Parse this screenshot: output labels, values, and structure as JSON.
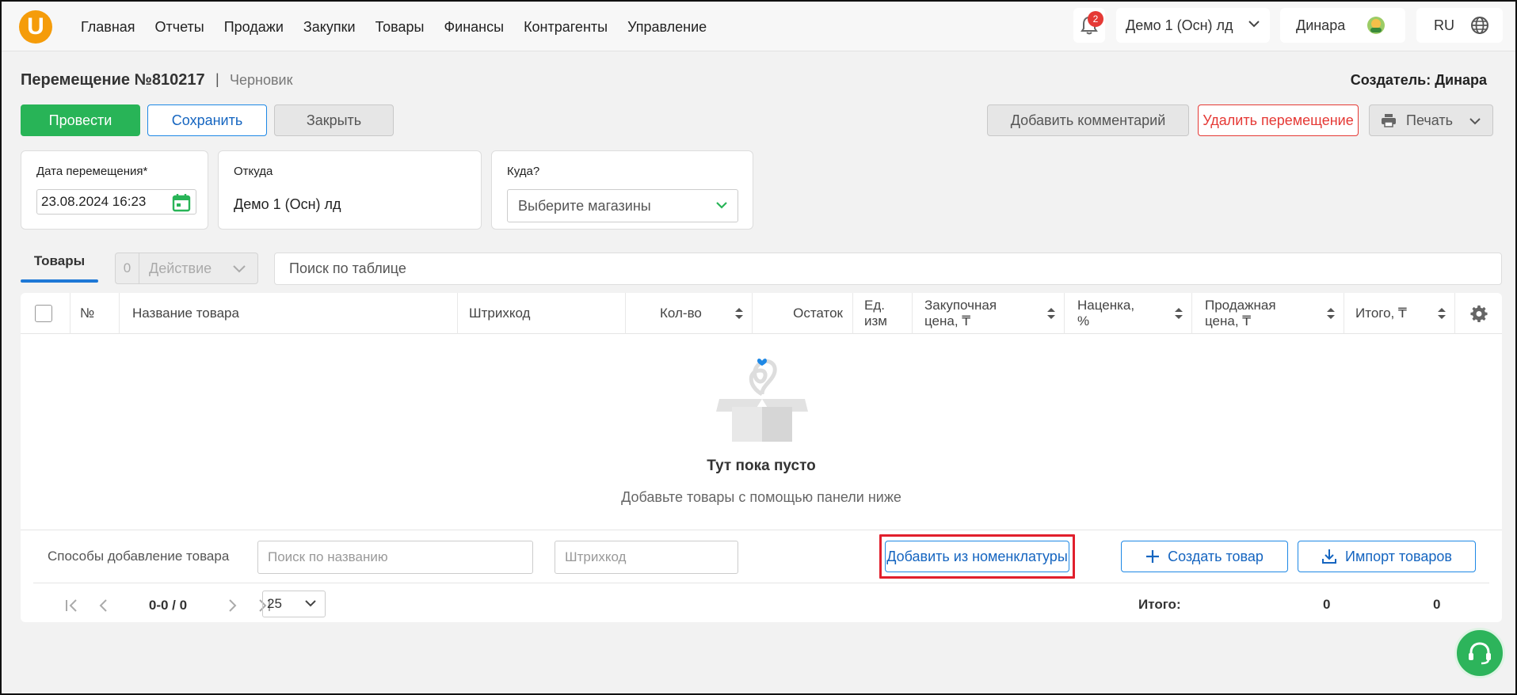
{
  "header": {
    "logo_text": "U",
    "nav": [
      "Главная",
      "Отчеты",
      "Продажи",
      "Закупки",
      "Товары",
      "Финансы",
      "Контрагенты",
      "Управление"
    ],
    "notifications_count": "2",
    "store": "Демо 1 (Осн) лд",
    "user": "Динара",
    "lang": "RU"
  },
  "doc": {
    "title": "Перемещение №810217",
    "separator": "|",
    "status": "Черновик",
    "creator": "Создатель: Динара"
  },
  "actions": {
    "post": "Провести",
    "save": "Сохранить",
    "close": "Закрыть",
    "add_comment": "Добавить комментарий",
    "delete": "Удалить перемещение",
    "print": "Печать"
  },
  "form": {
    "date_label": "Дата перемещения*",
    "date_value": "23.08.2024 16:23",
    "from_label": "Откуда",
    "from_value": "Демо 1 (Осн) лд",
    "to_label": "Куда?",
    "to_placeholder": "Выберите магазины"
  },
  "tabs": {
    "goods": "Товары",
    "action_count": "0",
    "action_label": "Действие",
    "search_placeholder": "Поиск по таблице"
  },
  "table": {
    "columns": {
      "num": "№",
      "name": "Название товара",
      "barcode": "Штрихкод",
      "qty": "Кол-во",
      "stock": "Остаток",
      "unit": "Ед. изм",
      "purchase": "Закупочная цена, ₸",
      "markup": "Наценка, %",
      "sale": "Продажная цена, ₸",
      "total": "Итого, ₸"
    },
    "empty_title": "Тут пока пусто",
    "empty_sub": "Добавьте товары с помощью панели ниже"
  },
  "add_panel": {
    "label": "Способы добавление товара",
    "name_placeholder": "Поиск по названию",
    "barcode_placeholder": "Штрихкод",
    "from_nomenclature": "Добавить из номенклатуры",
    "create": "Создать товар",
    "import": "Импорт товаров"
  },
  "footer": {
    "range": "0-0 / 0",
    "per_page": "25",
    "total_label": "Итого:",
    "total_qty": "0",
    "total_sum": "0"
  },
  "colors": {
    "accent_green": "#28b457",
    "accent_blue": "#1e88e5",
    "danger": "#e53935",
    "logo": "#f59c0a"
  }
}
